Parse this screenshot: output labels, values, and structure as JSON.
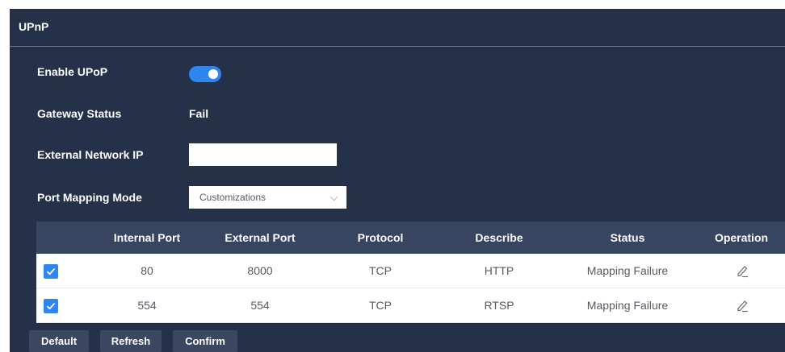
{
  "panel": {
    "title": "UPnP"
  },
  "form": {
    "enable_label": "Enable UPoP",
    "enable_on": true,
    "gateway_label": "Gateway Status",
    "gateway_value": "Fail",
    "ip_label": "External Network IP",
    "ip_value": "",
    "mode_label": "Port Mapping Mode",
    "mode_value": "Customizations"
  },
  "table": {
    "columns": [
      "Internal Port",
      "External Port",
      "Protocol",
      "Describe",
      "Status",
      "Operation"
    ],
    "rows": [
      {
        "checked": true,
        "internal_port": "80",
        "external_port": "8000",
        "protocol": "TCP",
        "describe": "HTTP",
        "status": "Mapping Failure",
        "operation_icon": "edit-pencil-icon"
      },
      {
        "checked": true,
        "internal_port": "554",
        "external_port": "554",
        "protocol": "TCP",
        "describe": "RTSP",
        "status": "Mapping Failure",
        "operation_icon": "edit-pencil-icon"
      }
    ]
  },
  "buttons": {
    "default": "Default",
    "refresh": "Refresh",
    "confirm": "Confirm"
  },
  "colors": {
    "panel_bg": "#253149",
    "header_bg": "#384560",
    "accent": "#2e86f0"
  }
}
